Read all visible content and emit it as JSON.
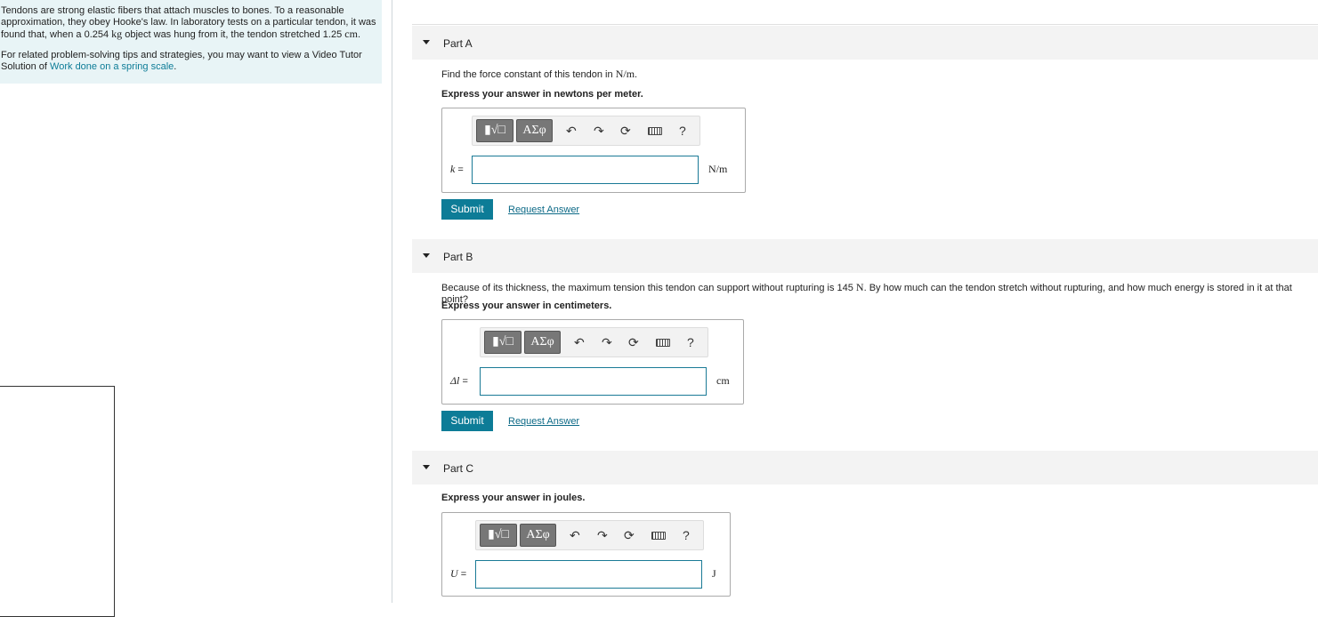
{
  "problem": {
    "p1_a": "Tendons are strong elastic fibers that attach muscles to bones. To a reasonable approximation, they obey Hooke's law. In laboratory tests on a particular tendon, it was found that, when a 0.254 ",
    "p1_mass_unit": "kg",
    "p1_b": " object was hung from it, the tendon stretched 1.25 ",
    "p1_len_unit": "cm",
    "p1_c": ".",
    "p2_a": "For related problem-solving tips and strategies, you may want to view a Video Tutor Solution of ",
    "p2_link": "Work done on a spring scale",
    "p2_b": "."
  },
  "toolbar": {
    "templates_icon": "▮√□",
    "symbols_label": "ΑΣφ",
    "help": "?"
  },
  "part_a": {
    "title": "Part A",
    "question_a": "Find the force constant of this tendon in ",
    "question_unit": "N/m",
    "question_b": ".",
    "express": "Express your answer in newtons per meter.",
    "var": "k",
    "eq": " =",
    "value": "",
    "unit": "N/m",
    "submit": "Submit",
    "request": "Request Answer"
  },
  "part_b": {
    "title": "Part B",
    "question_a": "Because of its thickness, the maximum tension this tendon can support without rupturing is 145 ",
    "question_unit": "N",
    "question_b": ". By how much can the tendon stretch without rupturing, and how much energy is stored in it at that point?",
    "express": "Express your answer in centimeters.",
    "var": "Δl",
    "eq": " =",
    "value": "",
    "unit": "cm",
    "submit": "Submit",
    "request": "Request Answer"
  },
  "part_c": {
    "title": "Part C",
    "express": "Express your answer in joules.",
    "var": "U",
    "eq": " =",
    "value": "",
    "unit": "J"
  }
}
